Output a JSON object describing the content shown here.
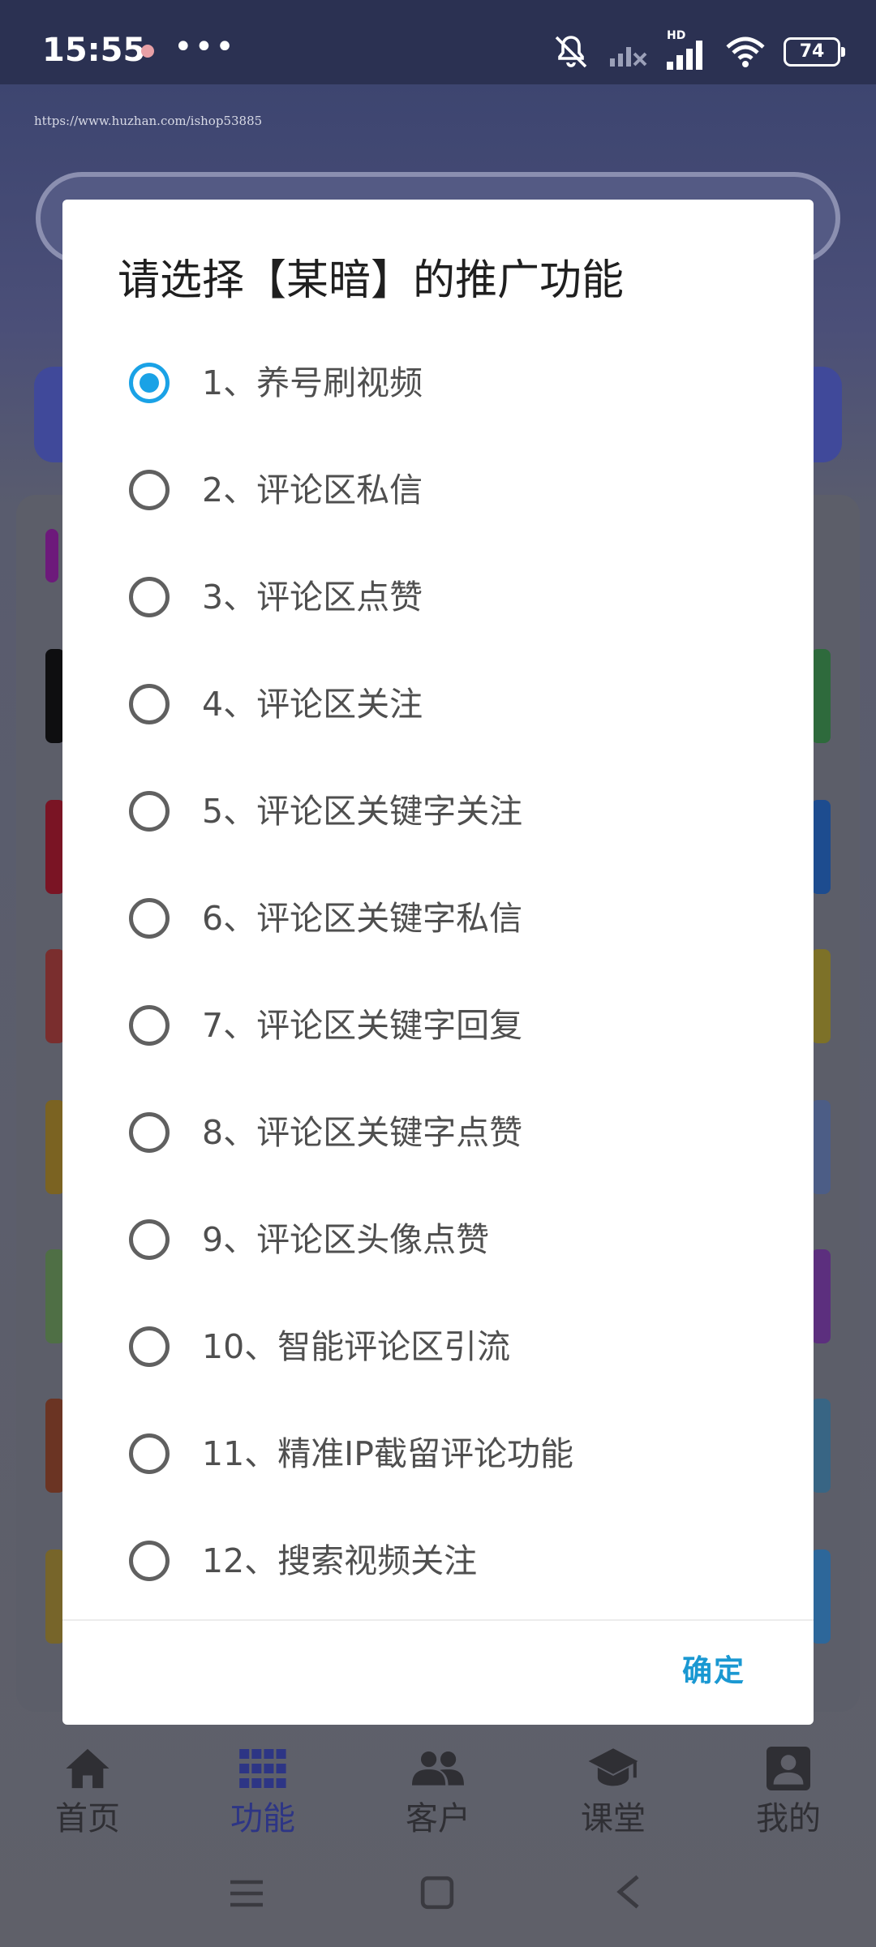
{
  "status_bar": {
    "time": "15:55",
    "dots": "•••",
    "network_label": "HD",
    "battery": "74"
  },
  "watermark": "https://www.huzhan.com/ishop53885",
  "dialog": {
    "title": "请选择【某暗】的推广功能",
    "options": [
      {
        "label": "1、养号刷视频",
        "selected": true
      },
      {
        "label": "2、评论区私信",
        "selected": false
      },
      {
        "label": "3、评论区点赞",
        "selected": false
      },
      {
        "label": "4、评论区关注",
        "selected": false
      },
      {
        "label": "5、评论区关键字关注",
        "selected": false
      },
      {
        "label": "6、评论区关键字私信",
        "selected": false
      },
      {
        "label": "7、评论区关键字回复",
        "selected": false
      },
      {
        "label": "8、评论区关键字点赞",
        "selected": false
      },
      {
        "label": "9、评论区头像点赞",
        "selected": false
      },
      {
        "label": "10、智能评论区引流",
        "selected": false
      },
      {
        "label": "11、精准IP截留评论功能",
        "selected": false
      },
      {
        "label": "12、搜索视频关注",
        "selected": false
      }
    ],
    "confirm_label": "确定"
  },
  "bottom_nav": {
    "items": [
      {
        "label": "首页",
        "icon": "home-icon"
      },
      {
        "label": "功能",
        "icon": "grid-icon",
        "active": true
      },
      {
        "label": "客户",
        "icon": "people-icon"
      },
      {
        "label": "课堂",
        "icon": "graduation-cap-icon"
      },
      {
        "label": "我的",
        "icon": "account-box-icon"
      }
    ]
  },
  "colors": {
    "accent": "#1aa2e6",
    "confirm": "#1a98d2",
    "nav_active": "#2d3585"
  }
}
